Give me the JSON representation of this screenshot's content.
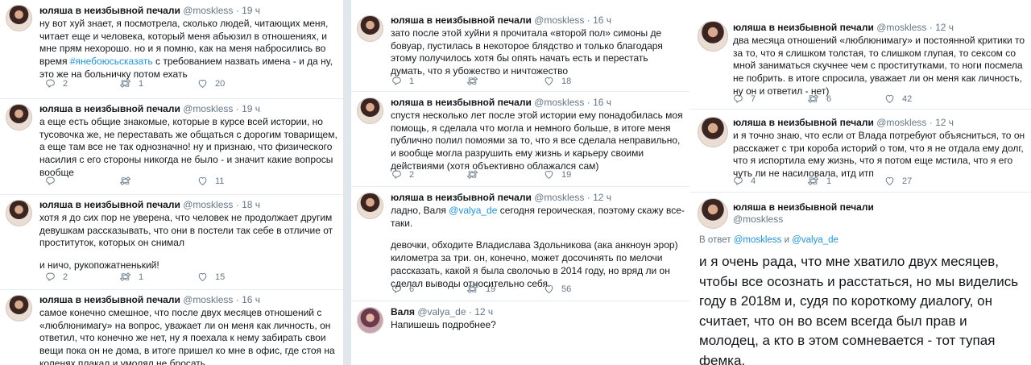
{
  "col1": [
    {
      "name": "юляша в неизбывной печали",
      "handle": "@moskless",
      "time": "19 ч",
      "text_before": "ну вот хуй знает, я посмотрела, сколько людей, читающих меня, читает еще и человека, который меня абьюзил в отношениях, и мне прям нехорошо. но и я помню, как на меня набросились во время ",
      "hashtag": "#янебоюсьсказать",
      "text_after": " с требованием назвать имена - и да ну, это же на больничку потом ехать",
      "replies": "2",
      "retweets": "1",
      "likes": "20"
    },
    {
      "name": "юляша в неизбывной печали",
      "handle": "@moskless",
      "time": "19 ч",
      "text": "а еще есть общие знакомые, которые в курсе всей истории, но тусовочка же, не переставать же общаться с дорогим товарищем, а еще там все не так однозначно! ну и признаю, что физического насилия с его стороны никогда не было - и значит какие вопросы вообще",
      "replies": "",
      "retweets": "",
      "likes": "11"
    },
    {
      "name": "юляша в неизбывной печали",
      "handle": "@moskless",
      "time": "18 ч",
      "text": "хотя я до сих пор не уверена, что человек не продолжает другим девушкам рассказывать, что они в постели так себе в отличие от проституток, которых он снимал",
      "text2": "и ничо, рукопожатненький!",
      "replies": "2",
      "retweets": "1",
      "likes": "15"
    },
    {
      "name": "юляша в неизбывной печали",
      "handle": "@moskless",
      "time": "16 ч",
      "text": "самое конечно смешное, что после двух месяцев отношений с «люблюнимагу» на вопрос, уважает ли он меня как личность, он ответил, что конечно же нет, ну я поехала к нему забирать свои вещи пока он не дома, в итоге пришел ко мне в офис, где стоя на коленях плакал и умолял не бросать"
    }
  ],
  "col2": [
    {
      "name": "юляша в неизбывной печали",
      "handle": "@moskless",
      "time": "16 ч",
      "text": "зато после этой хуйни я прочитала «второй пол» симоны де бовуар, пустилась в некоторое блядство и только благодаря этому получилось хотя бы опять начать есть и перестать думать, что я убожество и ничтожество",
      "replies": "1",
      "retweets": "",
      "likes": "18"
    },
    {
      "name": "юляша в неизбывной печали",
      "handle": "@moskless",
      "time": "16 ч",
      "text": "спустя несколько лет после этой истории ему понадобилась моя помощь, я сделала что могла и немного больше, в итоге меня публично полил помоями за то, что я все сделала неправильно, и вообще могла разрушить ему жизнь и карьеру своими действиями (хотя объективно облажался сам)",
      "replies": "2",
      "retweets": "",
      "likes": "19"
    },
    {
      "name": "юляша в неизбывной печали",
      "handle": "@moskless",
      "time": "12 ч",
      "text_before": "ладно, Валя ",
      "mention": "@valya_de",
      "text_after": " сегодня героическая, поэтому скажу все-таки.",
      "text2": "девочки, обходите Владислава Здольникова (ака анкноун эрор) километра за три. он, конечно, может досочинять по мелочи рассказать, какой я была сволочью в 2014 году, но вряд ли он сделал выводы относительно себя.",
      "replies": "6",
      "retweets": "19",
      "likes": "56"
    },
    {
      "name": "Валя",
      "handle": "@valya_de",
      "time": "12 ч",
      "text": "Напишешь подробнее?"
    }
  ],
  "col3": [
    {
      "name": "юляша в неизбывной печали",
      "handle": "@moskless",
      "time": "12 ч",
      "text": "два месяца отношений «люблюнимагу» и постоянной критики то за то, что я слишком толстая, то слишком глупая, то сексом со мной заниматься скучнее чем с проститутками, то ноги посмела не побрить. в итоге спросила, уважает ли он меня как личность, ну он и ответил - нет)",
      "replies": "7",
      "retweets": "6",
      "likes": "42"
    },
    {
      "name": "юляша в неизбывной печали",
      "handle": "@moskless",
      "time": "12 ч",
      "text": "и я точно знаю, что если от Влада потребуют объясниться, то он расскажет с три короба историй о том, что я не отдала ему долг, что я испортила ему жизнь, что я потом еще мстила, что я его чуть ли не насиловала, итд итп",
      "replies": "4",
      "retweets": "1",
      "likes": "27"
    }
  ],
  "main_tweet": {
    "name": "юляша в неизбывной печали",
    "handle": "@moskless",
    "reply_prefix": "В ответ",
    "reply_user1": "@moskless",
    "reply_and": "и",
    "reply_user2": "@valya_de",
    "text": "и я очень рада, что мне хватило двух месяцев, чтобы все осознать и расстаться, но мы виделись году в 2018м и, судя по короткому диалогу, он считает, что он во всем всегда был прав и молодец, а кто в этом сомневается - тот тупая фемка."
  },
  "colors": {
    "link": "#1b95e0",
    "muted": "#657786",
    "text": "#14171a",
    "border": "#e6ecf0"
  }
}
